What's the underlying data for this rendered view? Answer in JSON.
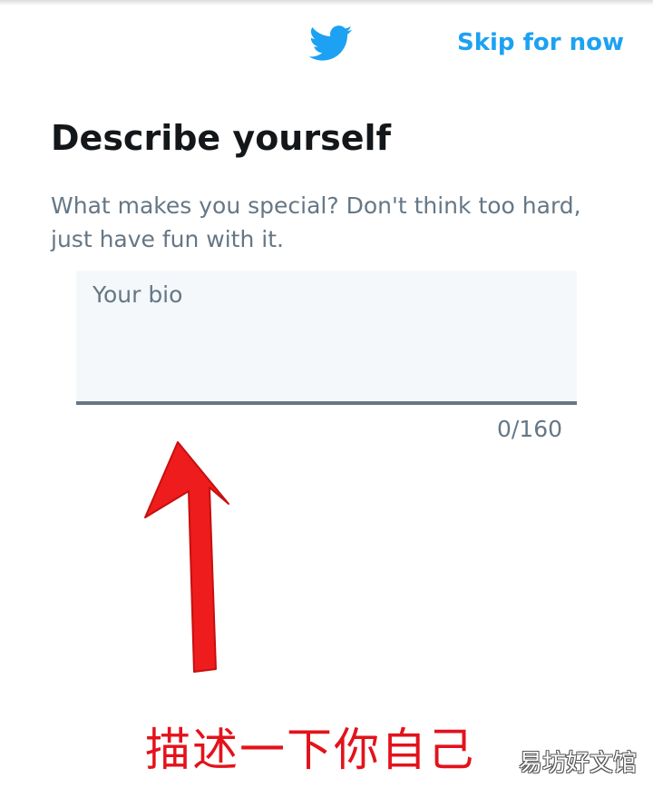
{
  "header": {
    "logo_icon": "twitter-bird-icon",
    "brand_color": "#1da1f2",
    "skip_label": "Skip for now"
  },
  "main": {
    "title": "Describe yourself",
    "subtitle": "What makes you special? Don't think too hard, just have fun with it.",
    "bio": {
      "placeholder": "Your bio",
      "value": "",
      "counter": "0/160",
      "max_length": 160
    }
  },
  "annotation": {
    "arrow_icon": "red-arrow-up-icon",
    "text": "描述一下你自己",
    "color": "#e3121b"
  },
  "watermark": {
    "text": "易坊好文馆"
  }
}
